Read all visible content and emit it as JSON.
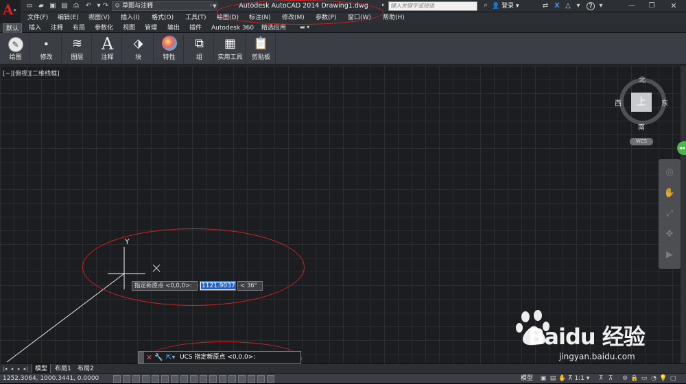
{
  "title_bar": {
    "workspace": "草图与注释",
    "app_title": "Autodesk AutoCAD 2014    Drawing1.dwg",
    "search_placeholder": "键入关键字或短语",
    "login": "登录"
  },
  "menu": [
    "文件(F)",
    "编辑(E)",
    "视图(V)",
    "插入(I)",
    "格式(O)",
    "工具(T)",
    "绘图(D)",
    "标注(N)",
    "修改(M)",
    "参数(P)",
    "窗口(W)",
    "帮助(H)"
  ],
  "ribbon_tabs": [
    "默认",
    "插入",
    "注释",
    "布局",
    "参数化",
    "视图",
    "管理",
    "输出",
    "插件",
    "Autodesk 360",
    "精选应用"
  ],
  "ribbon_panels": [
    "绘图",
    "修改",
    "图层",
    "注释",
    "块",
    "特性",
    "组",
    "实用工具",
    "剪贴板"
  ],
  "viewport_label": "[−][俯视][二维线框]",
  "viewcube": {
    "north": "北",
    "south": "南",
    "east": "东",
    "west": "西",
    "top_face": "上",
    "wcs": "WCS"
  },
  "ucs_icon": {
    "y_label": "Y"
  },
  "dynamic_input": {
    "prompt": "指定新原点 <0,0,0>:",
    "value": "1121.9037",
    "angle": "< 36°"
  },
  "command_line": {
    "text": "UCS 指定新原点 <0,0,0>:"
  },
  "layout_tabs": [
    "模型",
    "布局1",
    "布局2"
  ],
  "status_bar": {
    "coordinates": "1252.3064, 1000.3441, 0.0000",
    "model": "模型",
    "annotation_scale": "1:1"
  },
  "watermark": {
    "brand": "Baidu 经验",
    "url": "jingyan.baidu.com"
  },
  "colors": {
    "annotation_red": "#d42222",
    "canvas_bg": "#1c1d20",
    "accent_blue": "#1f5fd0"
  }
}
